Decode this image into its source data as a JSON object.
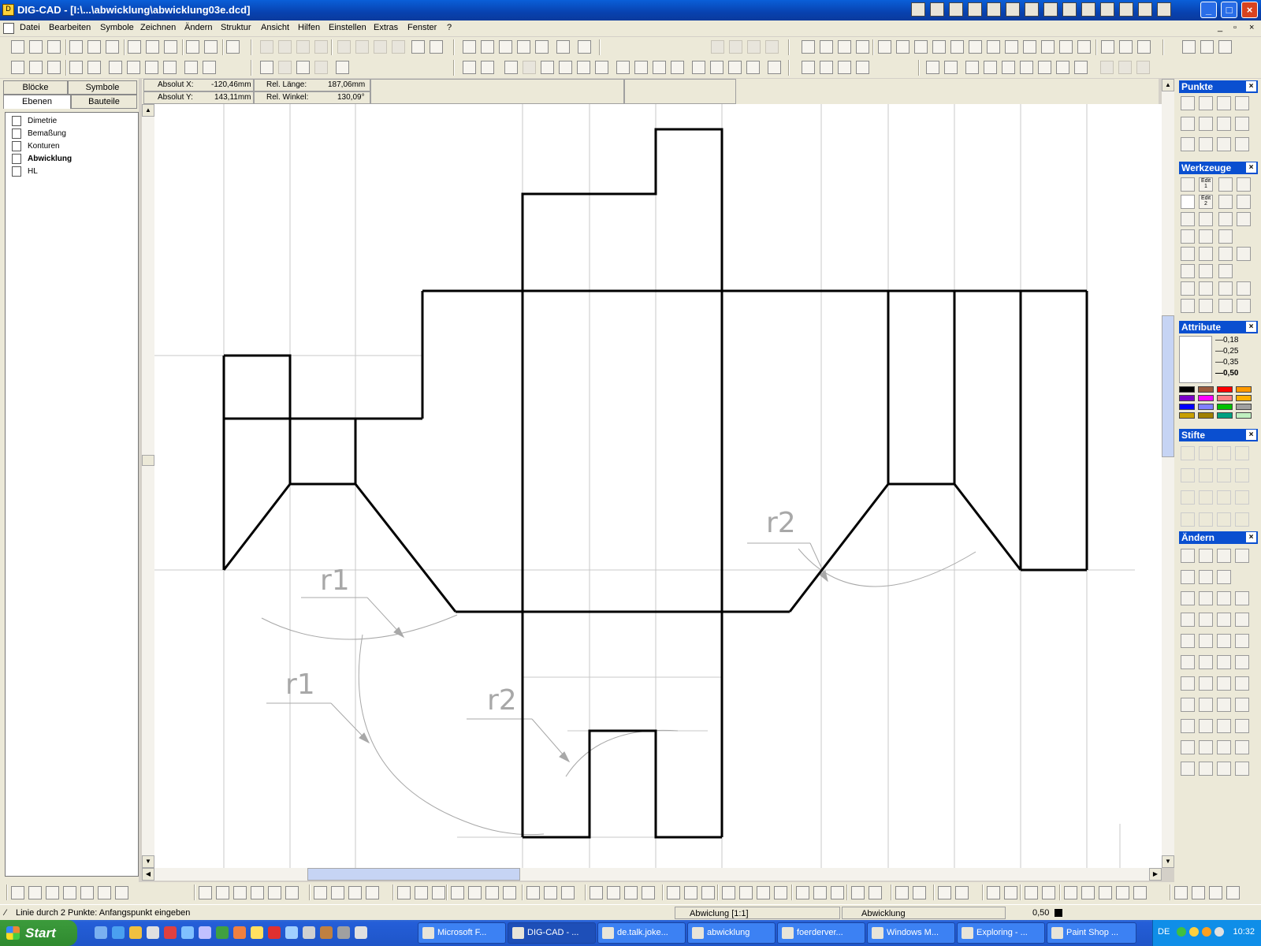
{
  "window": {
    "title": "DIG-CAD - [I:\\...\\abwicklung\\abwicklung03e.dcd]"
  },
  "menu": [
    "Datei",
    "Bearbeiten",
    "Symbole",
    "Zeichnen",
    "Ändern",
    "Struktur",
    "Ansicht",
    "Hilfen",
    "Einstellen",
    "Extras",
    "Fenster",
    "?"
  ],
  "left_panel": {
    "tabs": [
      "Blöcke",
      "Symbole",
      "Ebenen",
      "Bauteile"
    ],
    "layers": [
      {
        "name": "Dimetrie",
        "bold": false
      },
      {
        "name": "Bemaßung",
        "bold": false
      },
      {
        "name": "Konturen",
        "bold": false
      },
      {
        "name": "Abwicklung",
        "bold": true
      },
      {
        "name": "HL",
        "bold": false
      }
    ]
  },
  "coords": {
    "abs_x_label": "Absolut X:",
    "abs_x": "-120,46mm",
    "abs_y_label": "Absolut Y:",
    "abs_y": "143,11mm",
    "rel_len_label": "Rel. Länge:",
    "rel_len": "187,06mm",
    "rel_angle_label": "Rel. Winkel:",
    "rel_angle": "130,09°"
  },
  "drawing": {
    "labels": [
      "r1",
      "r1",
      "r2",
      "r2"
    ],
    "colors": {
      "contour": "#000000",
      "construction": "#c8c8c8",
      "annotation": "#a8a8a8"
    }
  },
  "right_panels": {
    "punkte": "Punkte",
    "werkzeuge": "Werkzeuge",
    "werkzeuge_edit": [
      "Edit 1",
      "Edit 2"
    ],
    "attribute": "Attribute",
    "line_widths": [
      "0,18",
      "0,25",
      "0,35",
      "0,50"
    ],
    "stifte": "Stifte",
    "aendern": "Ändern",
    "palette": [
      "#000000",
      "#9b5a3c",
      "#ff0000",
      "#ff9900",
      "#7a00c8",
      "#ff00ff",
      "#ff8080",
      "#ffb000",
      "#0000ff",
      "#8080ff",
      "#00c000",
      "#a0a0a0",
      "#c8a000",
      "#a08000",
      "#00a080",
      "#c0f0c0"
    ]
  },
  "status": {
    "hint": "Linie durch 2 Punkte: Anfangspunkt eingeben",
    "layer_scale": "Abwiclung [1:1]",
    "layer": "Abwicklung",
    "line_width": "0,50"
  },
  "taskbar": {
    "start": "Start",
    "tasks": [
      "Microsoft F...",
      "DIG-CAD - ...",
      "de.talk.joke...",
      "abwicklung",
      "foerderver...",
      "Windows M...",
      "Exploring - ...",
      "Paint Shop ..."
    ],
    "active_task": 1,
    "lang": "DE",
    "clock": "10:32"
  }
}
